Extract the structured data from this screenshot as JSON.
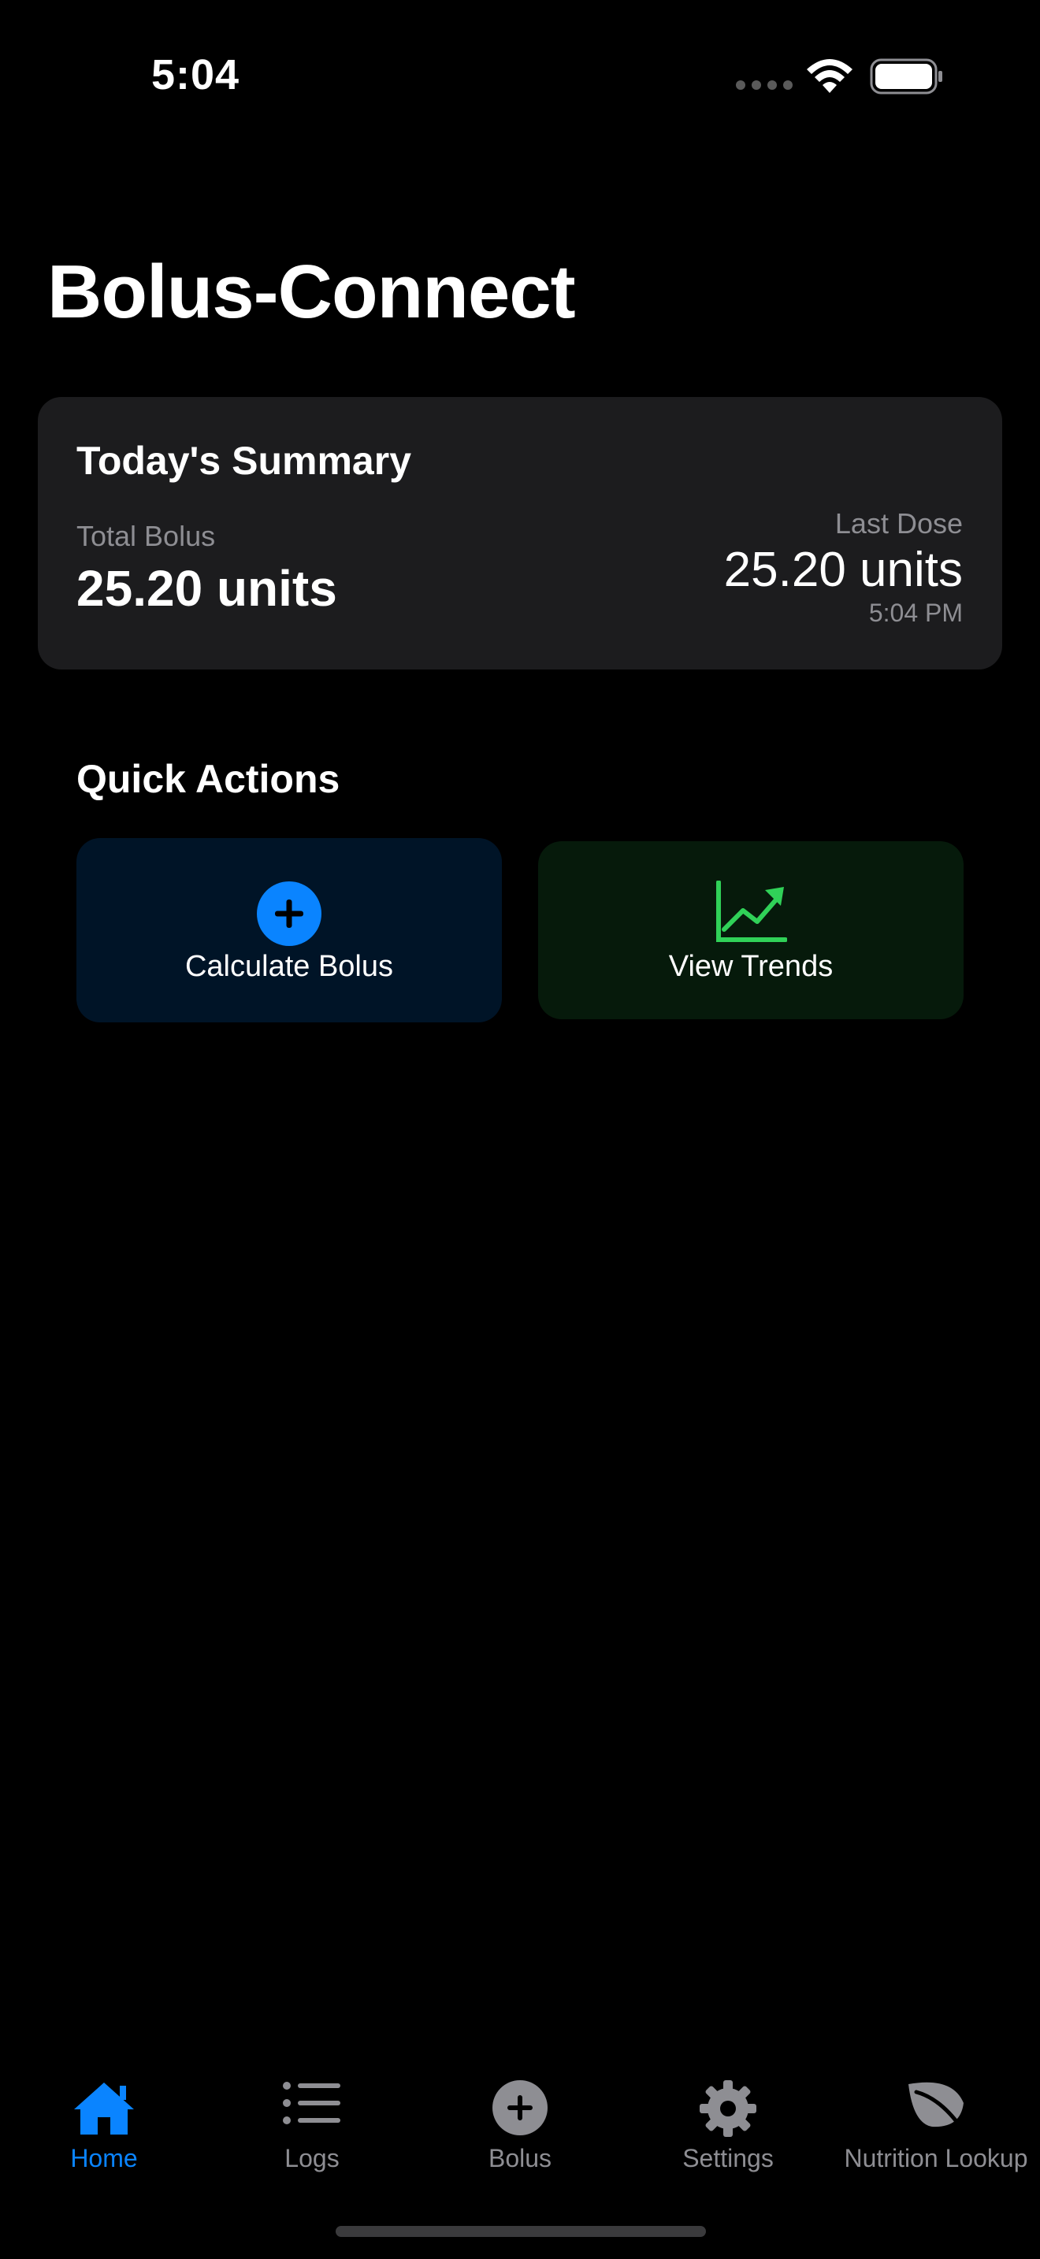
{
  "status_bar": {
    "time": "5:04"
  },
  "header": {
    "title": "Bolus-Connect"
  },
  "summary": {
    "title": "Today's Summary",
    "total_label": "Total Bolus",
    "total_value": "25.20 units",
    "last_label": "Last Dose",
    "last_value": "25.20 units",
    "last_time": "5:04 PM"
  },
  "quick_actions": {
    "title": "Quick Actions",
    "calculate_label": "Calculate Bolus",
    "trends_label": "View Trends"
  },
  "tabs": [
    {
      "label": "Home",
      "icon": "house-icon",
      "active": true
    },
    {
      "label": "Logs",
      "icon": "list-icon",
      "active": false
    },
    {
      "label": "Bolus",
      "icon": "plus-circle-icon",
      "active": false
    },
    {
      "label": "Settings",
      "icon": "gear-icon",
      "active": false
    },
    {
      "label": "Nutrition Lookup",
      "icon": "leaf-icon",
      "active": false
    }
  ],
  "colors": {
    "background": "#000000",
    "card": "#1c1c1e",
    "accent_blue": "#0a84ff",
    "accent_green": "#30d158",
    "secondary_text": "#8e8e93"
  }
}
